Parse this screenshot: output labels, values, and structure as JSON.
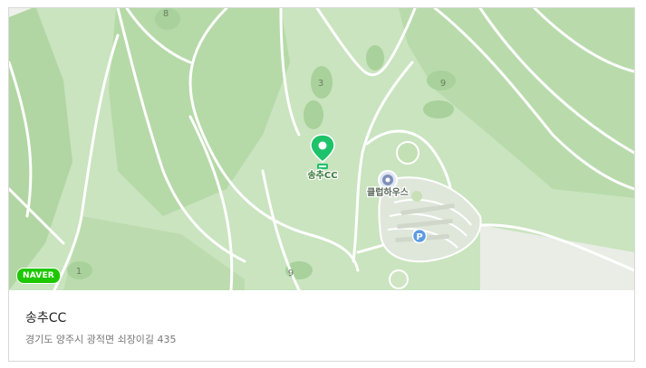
{
  "map": {
    "hole_numbers": [
      "8",
      "3",
      "9",
      "1",
      "9"
    ],
    "marker_label": "송추CC",
    "clubhouse_label": "클럽하우스",
    "parking_symbol": "P",
    "provider_badge": "NAVER",
    "marker_icon": "location-pin-icon",
    "clubhouse_icon": "clubhouse-icon",
    "parking_icon": "parking-icon",
    "colors": {
      "fairway": "#c9e4bf",
      "rough": "#b6d9a8",
      "road": "#ffffff",
      "marker": "#1ec26a",
      "badge": "#1ec800"
    }
  },
  "place": {
    "name": "송추CC",
    "address": "경기도 양주시 광적면 쇠장이길 435"
  }
}
